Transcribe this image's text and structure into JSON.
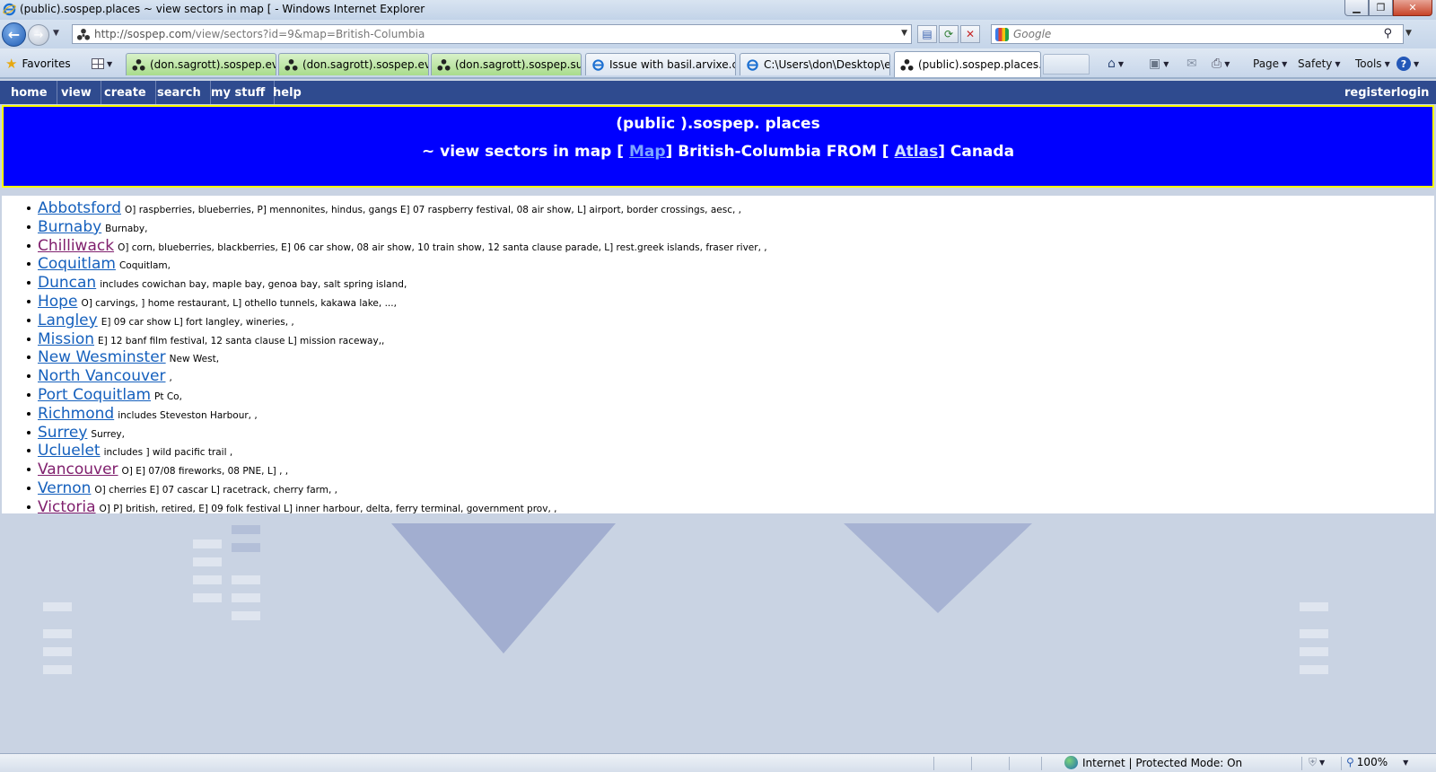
{
  "window": {
    "title": "(public).sospep.places ~ view sectors in map [ - Windows Internet Explorer",
    "minimize_label": "▁",
    "restore_label": "❐",
    "close_label": "✕"
  },
  "address": {
    "url_host": "http://sospep.com",
    "url_path": "/view/sectors?id=9&map=British-Columbia",
    "search_placeholder": "Google"
  },
  "toolbar": {
    "favorites_label": "Favorites",
    "tabs": [
      {
        "label": "(don.sagrott).sospep.eve...",
        "color": "green"
      },
      {
        "label": "(don.sagrott).sospep.eve...",
        "color": "green"
      },
      {
        "label": "(don.sagrott).sospep.subj...",
        "color": "green"
      },
      {
        "label": "Issue with basil.arvixe.com",
        "color": "plain"
      },
      {
        "label": "C:\\Users\\don\\Desktop\\e...",
        "color": "plain"
      },
      {
        "label": "(public).sospep.places...",
        "color": "active"
      }
    ],
    "page_label": "Page",
    "safety_label": "Safety",
    "tools_label": "Tools",
    "help_label": "?"
  },
  "site_nav": {
    "items": [
      "home",
      "view",
      "create",
      "search",
      "my stuff",
      "help"
    ],
    "register_label": "register",
    "login_label": "login"
  },
  "banner": {
    "title": "(public ).sospep. places",
    "sub_prefix": "~ view sectors in map [",
    "map_link": "Map",
    "region": "] British-Columbia FROM [",
    "atlas_link": "Atlas",
    "country": "] Canada"
  },
  "places": [
    {
      "name": "Abbotsford",
      "desc": "O] raspberries, blueberries, P] mennonites, hindus, gangs E] 07 raspberry festival, 08 air show, L] airport, border crossings, aesc, ,",
      "visited": false
    },
    {
      "name": "Burnaby",
      "desc": "Burnaby,",
      "visited": false
    },
    {
      "name": "Chilliwack",
      "desc": "O] corn, blueberries, blackberries, E] 06 car show, 08 air show, 10 train show, 12 santa clause parade, L] rest.greek islands, fraser river, ,",
      "visited": true
    },
    {
      "name": "Coquitlam",
      "desc": "Coquitlam,",
      "visited": false
    },
    {
      "name": "Duncan",
      "desc": "includes cowichan bay, maple bay, genoa bay, salt spring island,",
      "visited": false
    },
    {
      "name": "Hope",
      "desc": "O] carvings, ] home restaurant, L] othello tunnels, kakawa lake, ...,",
      "visited": false
    },
    {
      "name": "Langley",
      "desc": "E] 09 car show L] fort langley, wineries, ,",
      "visited": false
    },
    {
      "name": "Mission",
      "desc": "E] 12 banf film festival, 12 santa clause L] mission raceway,,",
      "visited": false
    },
    {
      "name": "New Wesminster",
      "desc": "New West,",
      "visited": false
    },
    {
      "name": "North Vancouver",
      "desc": ",",
      "visited": false
    },
    {
      "name": "Port Coquitlam",
      "desc": "Pt Co,",
      "visited": false
    },
    {
      "name": "Richmond",
      "desc": "includes Steveston Harbour, ,",
      "visited": false
    },
    {
      "name": "Surrey",
      "desc": "Surrey,",
      "visited": false
    },
    {
      "name": "Ucluelet",
      "desc": "includes ] wild pacific trail ,",
      "visited": false
    },
    {
      "name": "Vancouver",
      "desc": "O] E] 07/08 fireworks, 08 PNE, L] , ,",
      "visited": true
    },
    {
      "name": "Vernon",
      "desc": "O] cherries E] 07 cascar L] racetrack, cherry farm, ,",
      "visited": false
    },
    {
      "name": "Victoria",
      "desc": "O] P] british, retired, E] 09 folk festival L] inner harbour, delta, ferry terminal, government prov, ,",
      "visited": true
    }
  ],
  "status": {
    "zone": "Internet | Protected Mode: On",
    "zoom": "100%"
  },
  "colors": {
    "banner_bg": "#0000ff",
    "banner_border": "#ffff00",
    "nav_bg": "#2f4b8f",
    "link": "#1560bd",
    "link_visited": "#80206e"
  }
}
